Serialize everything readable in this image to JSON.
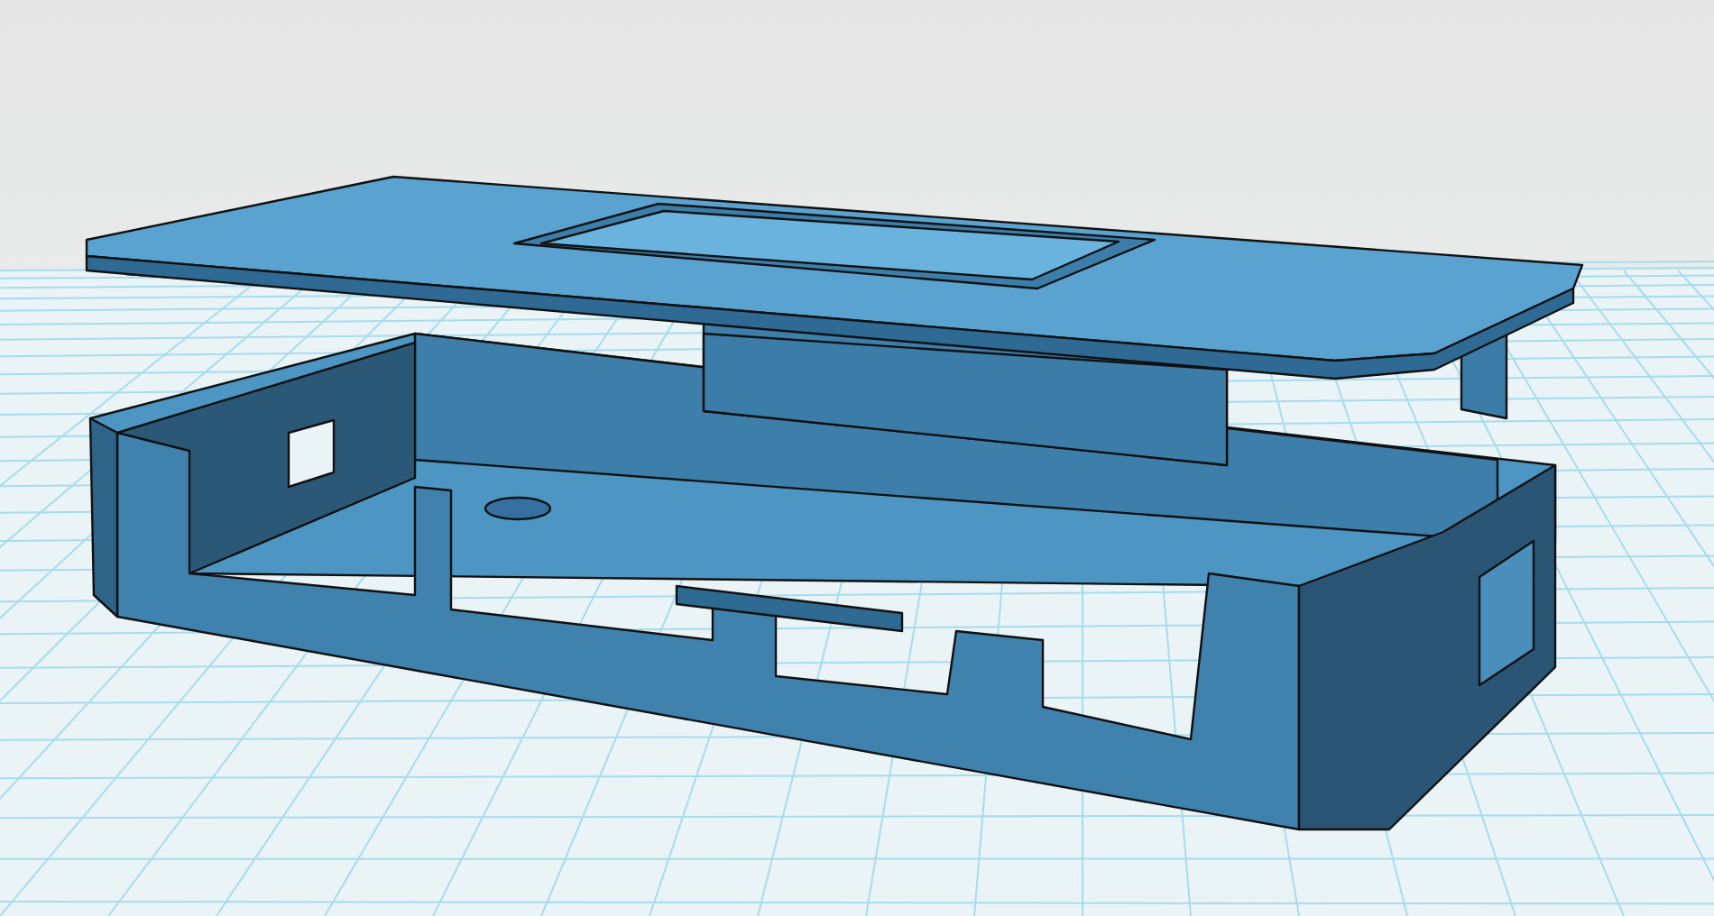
{
  "viewport": {
    "kind": "scene",
    "grid_visible": true
  }
}
